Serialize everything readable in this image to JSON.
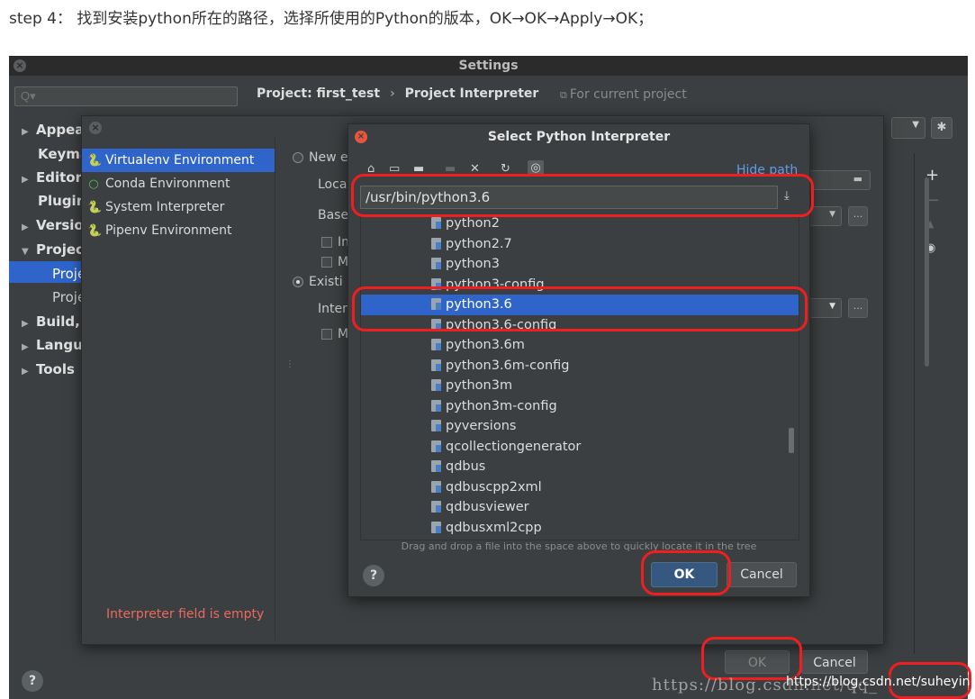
{
  "caption": "step 4： 找到安装python所在的路径，选择所使用的Python的版本，OK→OK→Apply→OK；",
  "settings": {
    "title": "Settings",
    "search_placeholder": "Q▾",
    "tree": [
      {
        "label": "Appeai",
        "arrow": "▶"
      },
      {
        "label": "Keyma",
        "arrow": ""
      },
      {
        "label": "Editor",
        "arrow": "▶"
      },
      {
        "label": "Plugin:",
        "arrow": ""
      },
      {
        "label": "Versior",
        "arrow": "▶"
      },
      {
        "label": "Project",
        "arrow": "▼"
      },
      {
        "label": "Proje",
        "arrow": ""
      },
      {
        "label": "Proje",
        "arrow": ""
      },
      {
        "label": "Build, I",
        "arrow": "▶"
      },
      {
        "label": "Langua",
        "arrow": "▶"
      },
      {
        "label": "Tools",
        "arrow": "▶"
      }
    ],
    "breadcrumb_project": "Project: first_test",
    "breadcrumb_sep": "›",
    "breadcrumb_page": "Project Interpreter",
    "for_current_project": "For current project",
    "ok_label": "OK",
    "cancel_label": "Cancel"
  },
  "add_dialog": {
    "environments": [
      {
        "label": "Virtualenv Environment",
        "icon": "🐍",
        "selected": true
      },
      {
        "label": "Conda Environment",
        "icon": "○",
        "selected": false
      },
      {
        "label": "System Interpreter",
        "icon": "🐍",
        "selected": false
      },
      {
        "label": "Pipenv Environment",
        "icon": "🐍",
        "selected": false
      }
    ],
    "new_env_label": "New e",
    "location_label": "Locat",
    "base_label": "Base",
    "inherit_label": "In",
    "make_label": "M",
    "existing_label": "Existi",
    "interpreter_label": "Inter",
    "make2_label": "M",
    "error": "Interpreter field is empty"
  },
  "select_dialog": {
    "title": "Select Python Interpreter",
    "hide_path": "Hide path",
    "path_value": "/usr/bin/python3.6",
    "files": [
      {
        "name": "python2",
        "selected": false
      },
      {
        "name": "python2.7",
        "selected": false
      },
      {
        "name": "python3",
        "selected": false
      },
      {
        "name": "python3-config",
        "selected": false
      },
      {
        "name": "python3.6",
        "selected": true
      },
      {
        "name": "python3.6-config",
        "selected": false
      },
      {
        "name": "python3.6m",
        "selected": false
      },
      {
        "name": "python3.6m-config",
        "selected": false
      },
      {
        "name": "python3m",
        "selected": false
      },
      {
        "name": "python3m-config",
        "selected": false
      },
      {
        "name": "pyversions",
        "selected": false
      },
      {
        "name": "qcollectiongenerator",
        "selected": false
      },
      {
        "name": "qdbus",
        "selected": false
      },
      {
        "name": "qdbuscpp2xml",
        "selected": false
      },
      {
        "name": "qdbusviewer",
        "selected": false
      },
      {
        "name": "qdbusxml2cpp",
        "selected": false
      }
    ],
    "drag_hint": "Drag and drop a file into the space above to quickly locate it in the tree",
    "ok_label": "OK",
    "cancel_label": "Cancel",
    "help_label": "?"
  },
  "watermark": "https://blog.csdn.net/qq_",
  "watermark_overlay": "https://blog.csdn.net/suheyin",
  "colors": {
    "accent_blue": "#2f65ca",
    "annotation_red": "#ef1f1f",
    "error_red": "#e86b5e",
    "link_blue": "#5f9ce6"
  }
}
